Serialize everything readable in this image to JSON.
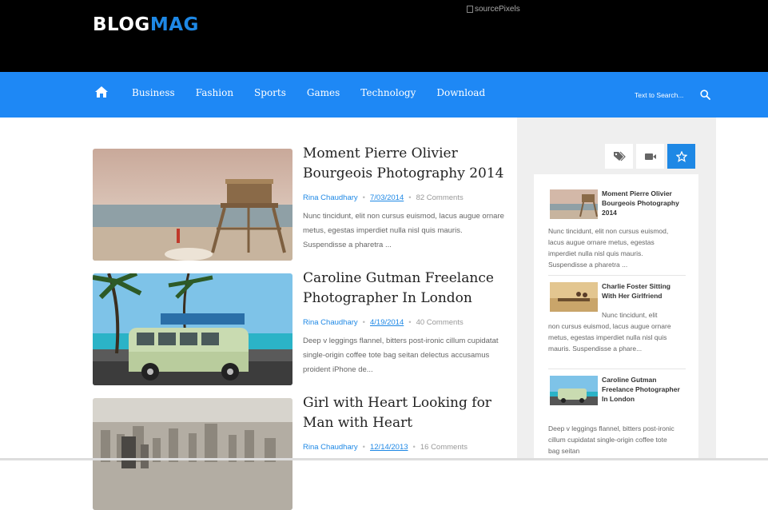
{
  "header": {
    "logo_part1": "BLOG",
    "logo_part2": "MAG",
    "ad_alt": "sourcePixels"
  },
  "nav": {
    "home_icon": "home-icon",
    "items": [
      "Business",
      "Fashion",
      "Sports",
      "Games",
      "Technology",
      "Download"
    ],
    "search_placeholder": "Text to Search...",
    "search_icon": "search-icon"
  },
  "posts": [
    {
      "title": "Moment Pierre Olivier Bourgeois Photography 2014",
      "author": "Rina Chaudhary",
      "date": "7/03/2014",
      "comments": "82 Comments",
      "excerpt": "Nunc tincidunt, elit non cursus euismod, lacus augue ornare metus, egestas imperdiet nulla nisl quis mauris. Suspendisse a pharetra ..."
    },
    {
      "title": "Caroline Gutman Freelance Photographer In London",
      "author": "Rina Chaudhary",
      "date": "4/19/2014",
      "comments": "40 Comments",
      "excerpt": "Deep v leggings flannel, bitters post-ironic cillum cupidatat single-origin coffee tote bag seitan delectus accusamus proident iPhone de..."
    },
    {
      "title": "Girl with Heart Looking for Man with Heart",
      "author": "Rina Chaudhary",
      "date": "12/14/2013",
      "comments": "16 Comments",
      "excerpt": ""
    }
  ],
  "sidebar": {
    "tabs": [
      "tag-icon",
      "video-icon",
      "star-icon"
    ],
    "active_tab": 2,
    "items": [
      {
        "title": "Moment Pierre Olivier Bourgeois Photography 2014",
        "excerpt": "Nunc tincidunt, elit non cursus euismod, lacus augue ornare metus, egestas imperdiet nulla nisl quis mauris. Suspendisse a pharetra ..."
      },
      {
        "title": "Charlie Foster Sitting With Her Girlfriend",
        "excerpt_part1": "Nunc tincidunt, elit",
        "excerpt_part2": "non cursus euismod, lacus augue ornare metus, egestas imperdiet nulla nisl quis mauris. Suspendisse a phare..."
      },
      {
        "title": "Caroline Gutman Freelance Photographer In London",
        "excerpt": "Deep v leggings flannel, bitters post-ironic cillum cupidatat single-origin coffee tote bag seitan"
      }
    ]
  },
  "colors": {
    "accent": "#1e88e5",
    "nav": "#1e88f5",
    "top": "#000000"
  }
}
